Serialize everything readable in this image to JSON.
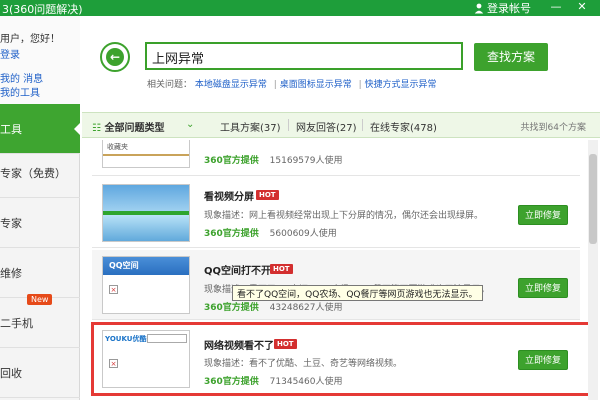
{
  "titlebar": {
    "title": "3(360问题解决)",
    "login_label": "登录帐号",
    "icons": [
      "user-icon",
      "minimize-icon",
      "close-icon"
    ]
  },
  "sidebar": {
    "greeting": "用户，您好！",
    "login_link": "登录",
    "links_row1": "我的   消息",
    "links_row2": "我的工具",
    "items": [
      {
        "label": "工具"
      },
      {
        "label": "专家（免费）"
      },
      {
        "label": "专家"
      },
      {
        "label": "维修"
      },
      {
        "label": "二手机"
      },
      {
        "label": "回收"
      }
    ],
    "new_badge": "New"
  },
  "search": {
    "value": "上网异常",
    "button_label": "查找方案",
    "related_label": "相关问题：",
    "related_links": [
      "本地磁盘显示异常",
      "桌面图标显示异常",
      "快捷方式显示异常"
    ]
  },
  "filters": {
    "all_types": "全部问题类型",
    "tab1": "工具方案(37)",
    "tab2": "网友回答(27)",
    "tab3": "在线专家(478)",
    "found": "共找到64个方案"
  },
  "results": [
    {
      "title": "",
      "hot": "",
      "desc": "",
      "provider": "360官方提供",
      "users": "15169579人使用",
      "button": ""
    },
    {
      "title": "看视频分屏",
      "hot": "HOT",
      "desc": "现象描述：网上看视频经常出现上下分屏的情况，偶尔还会出现绿屏。",
      "provider": "360官方提供",
      "users": "5600609人使用",
      "button": "立即修复"
    },
    {
      "title": "QQ空间打不开",
      "hot": "HOT",
      "desc": "现象描述：看不了QQ空间，QQ农场，QQ餐厅等网页游戏也无法显示。",
      "provider": "360官方提供",
      "users": "43248627人使用",
      "button": "立即修复"
    },
    {
      "title": "网络视频看不了",
      "hot": "HOT",
      "desc": "现象描述：看不了优酷、土豆、奇艺等网络视频。",
      "provider": "360官方提供",
      "users": "71345460人使用",
      "button": "立即修复"
    }
  ],
  "tooltip": "看不了QQ空间，QQ农场、QQ餐厅等网页游戏也无法显示。",
  "thumb_labels": {
    "qq_text": "QQ空间",
    "youku_text": "YOUKU优酷",
    "top_thumb_text": "收藏夹"
  },
  "colors": {
    "brand_green": "#3da22d",
    "hot_red": "#d32f2f",
    "highlight_red": "#e53935"
  }
}
